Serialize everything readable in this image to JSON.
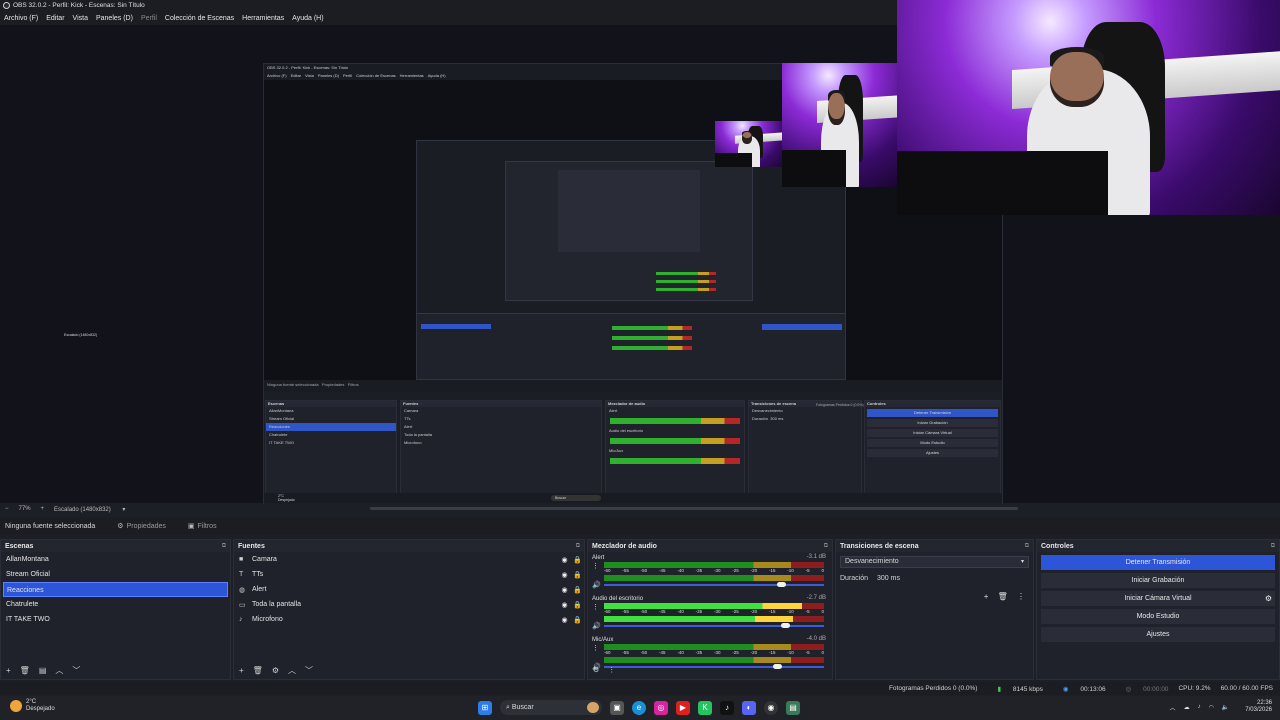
{
  "window": {
    "title": "OBS 32.0.2 - Perfil: Kick - Escenas: Sin Título"
  },
  "menu": [
    "Archivo (F)",
    "Editar",
    "Vista",
    "Paneles (D)",
    "Perfil",
    "Colección de Escenas",
    "Herramientas",
    "Ayuda (H)"
  ],
  "nested": {
    "title": "OBS 32.0.2 - Perfil: Kick - Escenas: Sin Título",
    "menu": [
      "Archivo (F)",
      "Editar",
      "Vista",
      "Paneles (D)",
      "Perfil",
      "Colección de Escenas",
      "Herramientas",
      "Ayuda (H)"
    ],
    "scenes_header": "Escenas",
    "sources_header": "Fuentes",
    "mixer_header": "Mezclador de audio",
    "transitions_header": "Transiciones de escena",
    "controls_header": "Controles",
    "scenes": [
      "AllanMontana",
      "Stream Oficial",
      "Reacciones",
      "Chatrulete",
      "IT TAKE TWO"
    ],
    "sources": [
      "Camara",
      "TTs",
      "Alert",
      "Toda la pantalla",
      "Microfono"
    ],
    "channels": [
      "Alert",
      "Audio del escritorio",
      "Mic/Aux"
    ],
    "transition": "Desvanecimiento",
    "duration_label": "Duración",
    "duration": "300 ms",
    "buttons": [
      "Detener Transmisión",
      "Iniciar Grabación",
      "Iniciar Cámara Virtual",
      "Modo Estudio",
      "Ajustes"
    ],
    "status": "Fotogramas Perdidos 0 (0.0%)",
    "no_source": "Ninguna fuente seleccionada",
    "properties": "Propiedades",
    "filters": "Filtros",
    "scale": "Escalado (1480x832)",
    "search": "Buscar",
    "temp": "2°C",
    "weather": "Despejado"
  },
  "zoom": {
    "level": "77%",
    "scale_label": "Escalado (1480x832)"
  },
  "selection": {
    "label": "Ninguna fuente seleccionada",
    "properties": "Propiedades",
    "filters": "Filtros"
  },
  "scenes": {
    "title": "Escenas",
    "items": [
      "AllanMontana",
      "Stream Oficial",
      "Reacciones",
      "Chatrulete",
      "IT TAKE TWO"
    ],
    "selected_index": 2
  },
  "sources": {
    "title": "Fuentes",
    "items": [
      {
        "label": "Camara",
        "icon": "camera-icon"
      },
      {
        "label": "TTs",
        "icon": "text-icon"
      },
      {
        "label": "Alert",
        "icon": "globe-icon"
      },
      {
        "label": "Toda la pantalla",
        "icon": "monitor-icon"
      },
      {
        "label": "Microfono",
        "icon": "microphone-icon"
      }
    ]
  },
  "mixer": {
    "title": "Mezclador de audio",
    "ticks": [
      "-60",
      "-55",
      "-50",
      "-45",
      "-40",
      "-35",
      "-30",
      "-25",
      "-20",
      "-15",
      "-10",
      "-5",
      "0"
    ],
    "channels": [
      {
        "name": "Alert",
        "db": "-3.1 dB",
        "level_a": 0.0,
        "level_b": 0.0,
        "volume": 0.82
      },
      {
        "name": "Audio del escritorio",
        "db": "-2.7 dB",
        "level_a": 0.9,
        "level_b": 0.86,
        "volume": 0.84
      },
      {
        "name": "Mic/Aux",
        "db": "-4.0 dB",
        "level_a": 0.0,
        "level_b": 0.0,
        "volume": 0.8
      }
    ]
  },
  "transitions": {
    "title": "Transiciones de escena",
    "selected": "Desvanecimiento",
    "duration_label": "Duración",
    "duration": "300 ms"
  },
  "controls": {
    "title": "Controles",
    "buttons": [
      "Detener Transmisión",
      "Iniciar Grabación",
      "Iniciar Cámara Virtual",
      "Modo Estudio",
      "Ajustes"
    ]
  },
  "status": {
    "dropped": "Fotogramas Perdidos 0 (0.0%)",
    "bitrate": "8145 kbps",
    "stream_time": "00:13:06",
    "rec_time": "00:00:00",
    "cpu": "CPU: 9.2%",
    "fps": "60.00 / 60.00 FPS"
  },
  "taskbar": {
    "temp": "2°C",
    "weather": "Despejado",
    "search": "Buscar",
    "time": "22:36",
    "date": "7/03/2026"
  },
  "colors": {
    "accent": "#2d55d8",
    "meter_green": "#3fe03f",
    "meter_yellow": "#ffd43a",
    "meter_red": "#b52626"
  }
}
